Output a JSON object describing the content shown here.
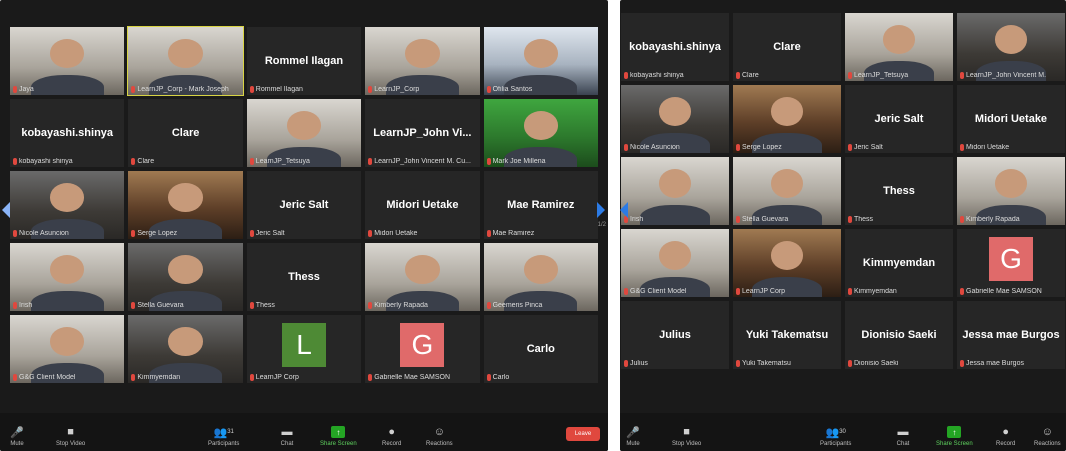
{
  "left_window": {
    "page_indicator": "1/2",
    "tiles": [
      {
        "type": "video",
        "name": "Jaya",
        "style": "light",
        "active": false
      },
      {
        "type": "video",
        "name": "LearnJP_Corp - Mark Joseph",
        "style": "light",
        "active": true
      },
      {
        "type": "name",
        "name": "Rommel Ilagan",
        "display": "Rommel Ilagan"
      },
      {
        "type": "video",
        "name": "LearnJP_Corp",
        "style": "light",
        "active": false
      },
      {
        "type": "video",
        "name": "Ofilia Santos",
        "style": "blue",
        "active": false
      },
      {
        "type": "name",
        "name": "kobayashi shinya",
        "display": "kobayashi.shinya"
      },
      {
        "type": "name",
        "name": "Clare",
        "display": "Clare"
      },
      {
        "type": "video",
        "name": "LearnJP_Tetsuya",
        "style": "light",
        "active": false
      },
      {
        "type": "name",
        "name": "LearnJP_John Vincent M. Cu...",
        "display": "LearnJP_John Vi..."
      },
      {
        "type": "video",
        "name": "Mark Joe Millena",
        "style": "green",
        "active": false
      },
      {
        "type": "video",
        "name": "Nicole Asuncion",
        "style": "dark",
        "active": false
      },
      {
        "type": "video",
        "name": "Serge Lopez",
        "style": "warm",
        "active": false
      },
      {
        "type": "name",
        "name": "Jeric Salt",
        "display": "Jeric Salt"
      },
      {
        "type": "name",
        "name": "Midori Uetake",
        "display": "Midori Uetake"
      },
      {
        "type": "name",
        "name": "Mae Ramirez",
        "display": "Mae Ramirez"
      },
      {
        "type": "video",
        "name": "Irish",
        "style": "light",
        "active": false
      },
      {
        "type": "video",
        "name": "Stella Guevara",
        "style": "dark",
        "active": false
      },
      {
        "type": "name",
        "name": "Thess",
        "display": "Thess"
      },
      {
        "type": "video",
        "name": "Kimberly Rapada",
        "style": "light",
        "active": false
      },
      {
        "type": "video",
        "name": "Geemeris Pinca",
        "style": "light",
        "active": false
      },
      {
        "type": "video",
        "name": "G&G Client Model",
        "style": "light",
        "active": false
      },
      {
        "type": "video",
        "name": "Kimmyemdan",
        "style": "dark",
        "active": false
      },
      {
        "type": "avatar",
        "name": "LearnJP Corp",
        "letter": "L",
        "color": "#4e8a35"
      },
      {
        "type": "avatar",
        "name": "Gabrielle Mae SAMSON",
        "letter": "G",
        "color": "#e06a6a"
      },
      {
        "type": "name",
        "name": "Carlo",
        "display": "Carlo"
      }
    ],
    "toolbar": {
      "mute": "Mute",
      "stop_video": "Stop Video",
      "participants": "Participants",
      "participants_count": "31",
      "chat": "Chat",
      "share_screen": "Share Screen",
      "record": "Record",
      "reactions": "Reactions",
      "end": "Leave"
    }
  },
  "right_window": {
    "tiles": [
      {
        "type": "name",
        "name": "kobayashi shinya",
        "display": "kobayashi.shinya"
      },
      {
        "type": "name",
        "name": "Clare",
        "display": "Clare"
      },
      {
        "type": "video",
        "name": "LearnJP_Tetsuya",
        "style": "light",
        "active": false
      },
      {
        "type": "video",
        "name": "LearnJP_John Vincent M.",
        "style": "dark",
        "active": false
      },
      {
        "type": "video",
        "name": "Nicole Asuncion",
        "style": "dark",
        "active": false
      },
      {
        "type": "video",
        "name": "Serge Lopez",
        "style": "warm",
        "active": false
      },
      {
        "type": "name",
        "name": "Jeric Salt",
        "display": "Jeric Salt"
      },
      {
        "type": "name",
        "name": "Midori Uetake",
        "display": "Midori Uetake"
      },
      {
        "type": "video",
        "name": "Irish",
        "style": "light",
        "active": false
      },
      {
        "type": "video",
        "name": "Stella Guevara",
        "style": "light",
        "active": false
      },
      {
        "type": "name",
        "name": "Thess",
        "display": "Thess"
      },
      {
        "type": "video",
        "name": "Kimberly Rapada",
        "style": "light",
        "active": false
      },
      {
        "type": "video",
        "name": "G&G Client Model",
        "style": "light",
        "active": false
      },
      {
        "type": "video",
        "name": "LearnJP Corp",
        "style": "warm",
        "active": false
      },
      {
        "type": "name",
        "name": "Kimmyemdan",
        "display": "Kimmyemdan"
      },
      {
        "type": "avatar",
        "name": "Gabrielle Mae SAMSON",
        "letter": "G",
        "color": "#e06a6a"
      },
      {
        "type": "name",
        "name": "Julius",
        "display": "Julius"
      },
      {
        "type": "name",
        "name": "Yuki Takematsu",
        "display": "Yuki Takematsu"
      },
      {
        "type": "name",
        "name": "Dionisio Saeki",
        "display": "Dionisio Saeki"
      },
      {
        "type": "name",
        "name": "Jessa mae Burgos",
        "display": "Jessa mae Burgos"
      }
    ],
    "toolbar": {
      "mute": "Mute",
      "stop_video": "Stop Video",
      "participants": "Participants",
      "participants_count": "30",
      "chat": "Chat",
      "share_screen": "Share Screen",
      "record": "Record",
      "reactions": "Reactions"
    }
  }
}
